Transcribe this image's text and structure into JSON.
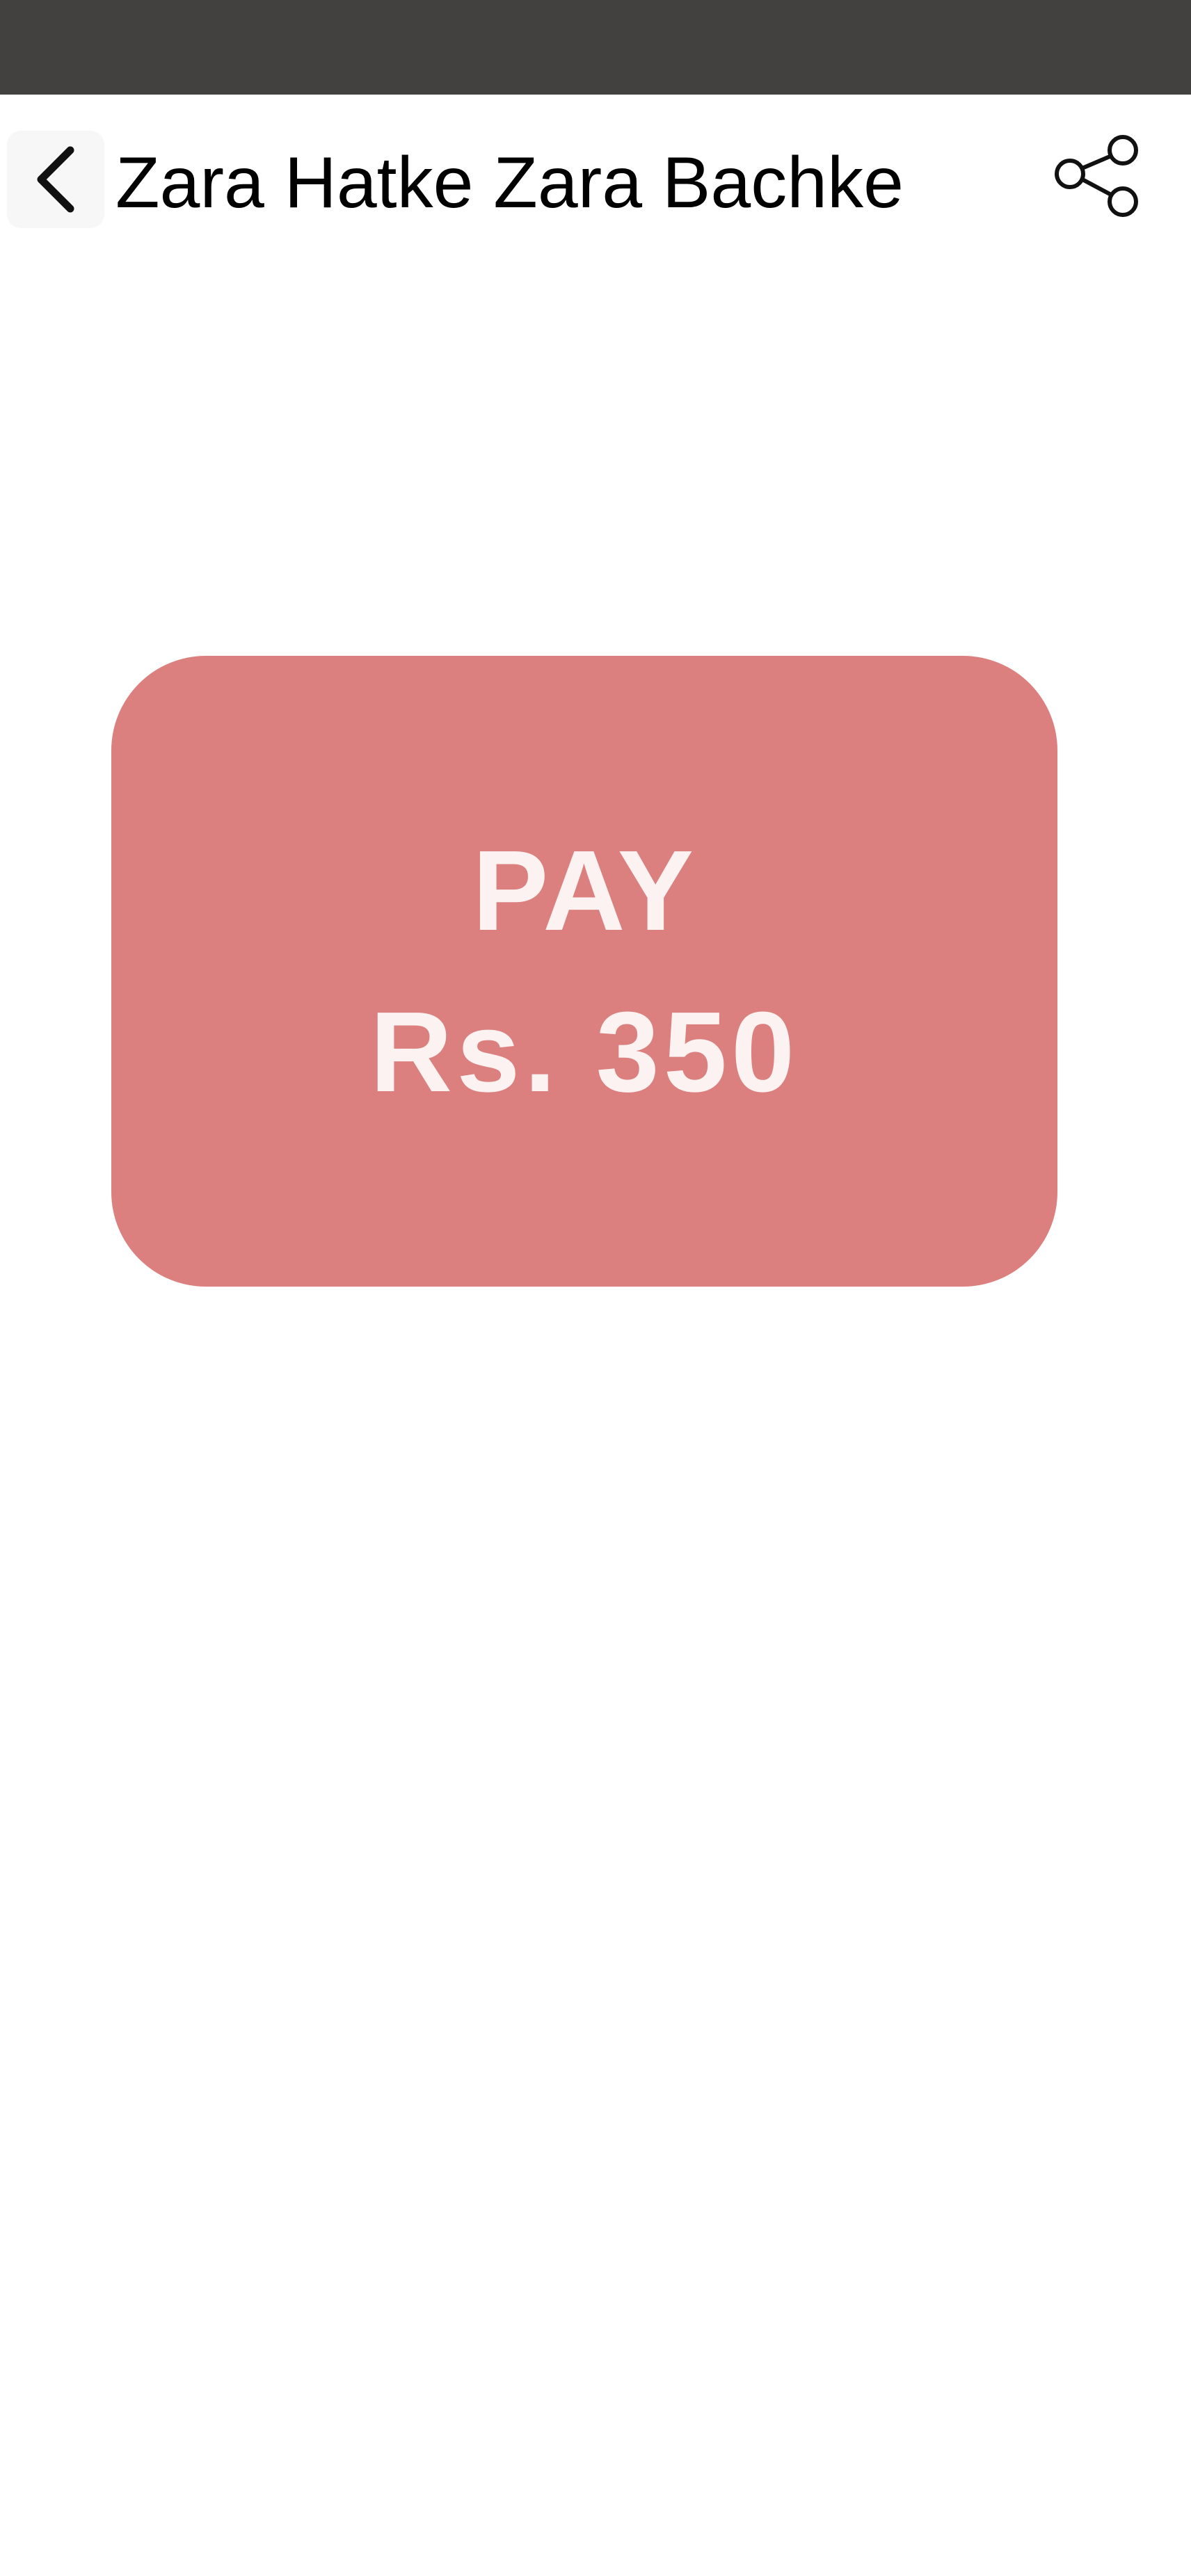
{
  "header": {
    "title": "Zara Hatke Zara Bachke",
    "back_icon": "chevron-left-icon",
    "share_icon": "share-icon"
  },
  "payment": {
    "label": "PAY",
    "amount": "Rs. 350",
    "button_color": "#dc807f"
  },
  "theme": {
    "status_bar_color": "#434140",
    "background": "#ffffff"
  }
}
